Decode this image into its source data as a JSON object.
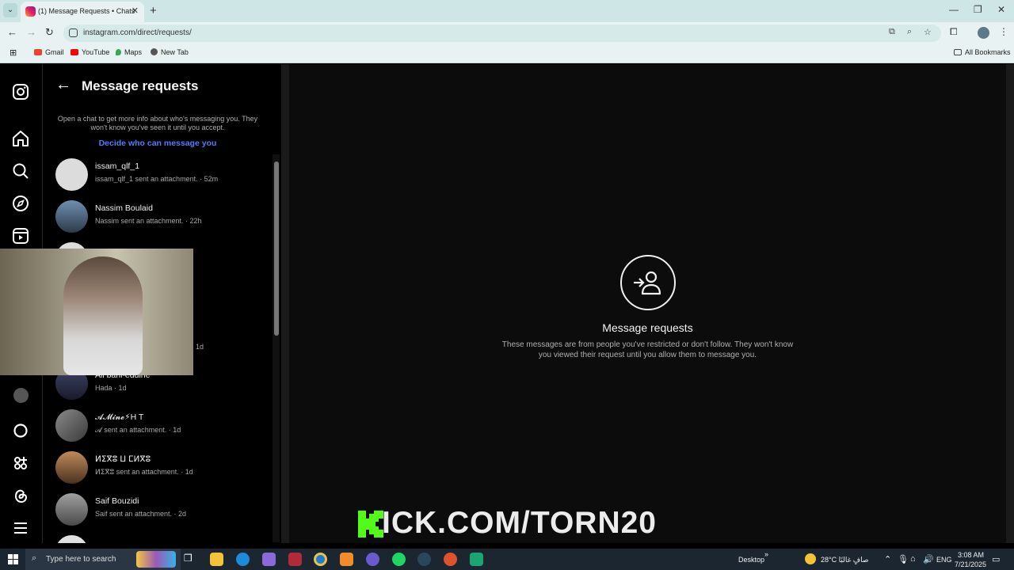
{
  "browser": {
    "tab_title": "(1) Message Requests • Chats",
    "url": "instagram.com/direct/requests/",
    "bookmarks": [
      "Gmail",
      "YouTube",
      "Maps",
      "New Tab"
    ],
    "all_bookmarks": "All Bookmarks"
  },
  "requests": {
    "title": "Message requests",
    "info": "Open a chat to get more info about who's messaging you. They won't know you've seen it until you accept.",
    "decide_link": "Decide who can message you",
    "items": [
      {
        "name": "issam_qlf_1",
        "sub": "issam_qlf_1 sent an attachment. · 52m"
      },
      {
        "name": "Nassim Boulaid",
        "sub": "Nassim sent an attachment. · 22h"
      },
      {
        "name": "Ali bani-eddine",
        "sub": "Hada · 1d"
      },
      {
        "name": "𝓐𝓜𝓲𝓷𝓮⚡H T",
        "sub": "𝓐 sent an attachment. · 1d"
      },
      {
        "name": "ⵍⵉⴳⵓ ⵡ ⵎⵍⴳⵓ",
        "sub": "ⵍⵉⴳⵓ sent an attachment. · 1d"
      },
      {
        "name": "Saif Bouzidi",
        "sub": "Saif sent an attachment. · 2d"
      }
    ],
    "hidden_row_time": "1d"
  },
  "main": {
    "title": "Message requests",
    "description": "These messages are from people you've restricted or don't follow. They won't know you viewed their request until you allow them to message you."
  },
  "overlay": {
    "kick_url": "ICK.COM/TORN20"
  },
  "taskbar": {
    "search_placeholder": "Type here to search",
    "desktop": "Desktop",
    "weather": "28°C  صافٍ غالبًا",
    "lang": "ENG",
    "time": "3:08 AM",
    "date": "7/21/2025"
  }
}
